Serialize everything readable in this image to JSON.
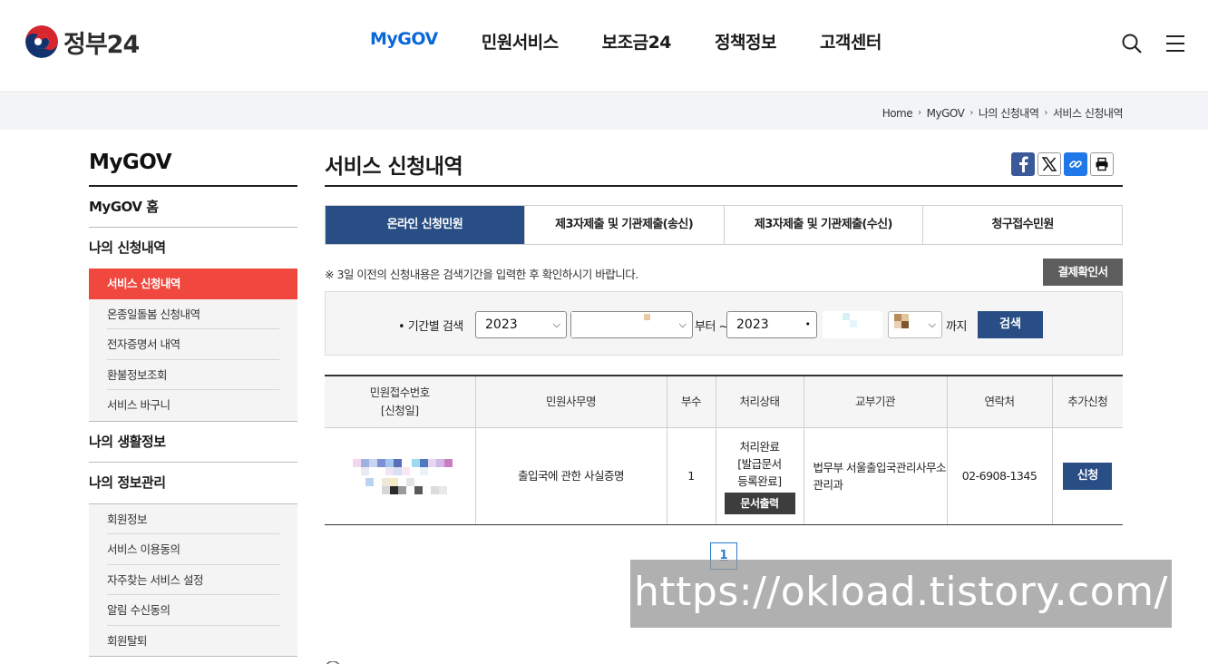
{
  "header": {
    "logo_text": "정부24",
    "nav": [
      "MyGOV",
      "민원서비스",
      "보조금24",
      "정책정보",
      "고객센터"
    ],
    "active_nav": "MyGOV"
  },
  "breadcrumb": [
    "Home",
    "MyGOV",
    "나의 신청내역",
    "서비스 신청내역"
  ],
  "sidebar": {
    "title": "MyGOV",
    "home": "MyGOV 홈",
    "section1": {
      "label": "나의 신청내역",
      "items": [
        "서비스 신청내역",
        "온종일돌봄 신청내역",
        "전자증명서 내역",
        "환불정보조회",
        "서비스 바구니"
      ],
      "active": "서비스 신청내역"
    },
    "section2": {
      "label": "나의 생활정보"
    },
    "section3": {
      "label": "나의 정보관리",
      "items": [
        "회원정보",
        "서비스 이용동의",
        "자주찾는 서비스 설정",
        "알림 수신동의",
        "회원탈퇴"
      ]
    }
  },
  "main": {
    "title": "서비스 신청내역",
    "tabs": [
      "온라인 신청민원",
      "제3자제출 및 기관제출(송신)",
      "제3자제출 및 기관제출(수신)",
      "청구접수민원"
    ],
    "active_tab": "온라인 신청민원",
    "notice": "※ 3일 이전의 신청내용은 검색기간을 입력한 후 확인하시기 바랍니다.",
    "receipt_button": "결제확인서",
    "search": {
      "label": "• 기간별 검색",
      "from_year": "2023",
      "to_year": "2023",
      "from_text": "부터 ~",
      "to_text": "까지",
      "button": "검색"
    },
    "table": {
      "headers": [
        "민원접수번호",
        "[신청일]",
        "민원사무명",
        "부수",
        "처리상태",
        "교부기관",
        "연락처",
        "추가신청"
      ],
      "row": {
        "service_name": "출입국에 관한 사실증명",
        "copies": "1",
        "status_line1": "처리완료",
        "status_line2": "[발급문서",
        "status_line3": "등록완료]",
        "print_button": "문서출력",
        "agency": "법무부 서울출입국관리사무소 관리과",
        "contact": "02-6908-1345",
        "apply_button": "신청"
      }
    },
    "pagination": {
      "current": "1"
    }
  },
  "watermark": "https://okload.tistory.com/",
  "colors": {
    "brand_blue": "#284e85",
    "active_red": "#f0483e",
    "nav_active": "#0a67d8"
  }
}
